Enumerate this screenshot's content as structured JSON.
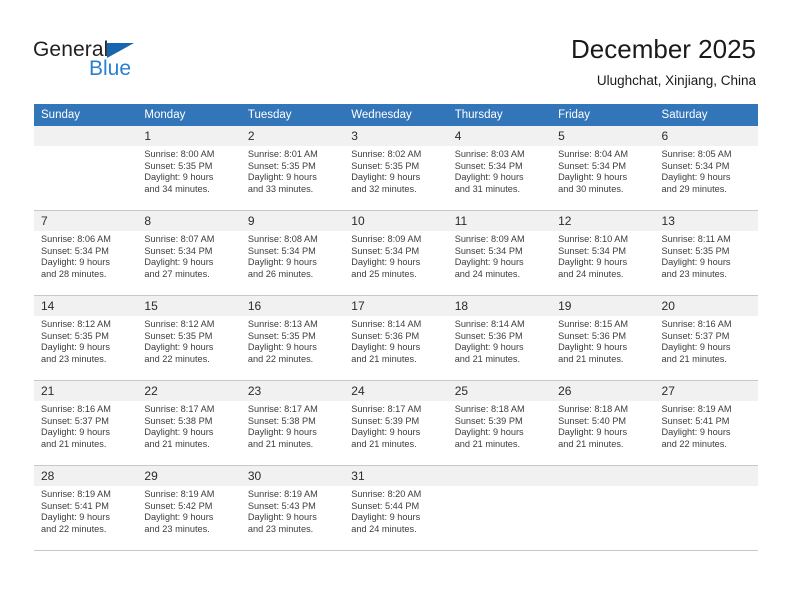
{
  "brand": {
    "name_part1": "General",
    "name_part2": "Blue",
    "triangle_color": "#1565b0",
    "blue_color": "#2a7fd4"
  },
  "header": {
    "title": "December 2025",
    "subtitle": "Ulughchat, Xinjiang, China"
  },
  "theme": {
    "header_row_bg": "#3275b8",
    "daynum_bg": "#f1f1f1",
    "grid_line": "#c8c8c8",
    "text": "#3d3d3d"
  },
  "weekdays": [
    "Sunday",
    "Monday",
    "Tuesday",
    "Wednesday",
    "Thursday",
    "Friday",
    "Saturday"
  ],
  "weeks": [
    [
      {
        "day": "",
        "sunrise": "",
        "sunset": "",
        "daylight1": "",
        "daylight2": ""
      },
      {
        "day": "1",
        "sunrise": "Sunrise: 8:00 AM",
        "sunset": "Sunset: 5:35 PM",
        "daylight1": "Daylight: 9 hours",
        "daylight2": "and 34 minutes."
      },
      {
        "day": "2",
        "sunrise": "Sunrise: 8:01 AM",
        "sunset": "Sunset: 5:35 PM",
        "daylight1": "Daylight: 9 hours",
        "daylight2": "and 33 minutes."
      },
      {
        "day": "3",
        "sunrise": "Sunrise: 8:02 AM",
        "sunset": "Sunset: 5:35 PM",
        "daylight1": "Daylight: 9 hours",
        "daylight2": "and 32 minutes."
      },
      {
        "day": "4",
        "sunrise": "Sunrise: 8:03 AM",
        "sunset": "Sunset: 5:34 PM",
        "daylight1": "Daylight: 9 hours",
        "daylight2": "and 31 minutes."
      },
      {
        "day": "5",
        "sunrise": "Sunrise: 8:04 AM",
        "sunset": "Sunset: 5:34 PM",
        "daylight1": "Daylight: 9 hours",
        "daylight2": "and 30 minutes."
      },
      {
        "day": "6",
        "sunrise": "Sunrise: 8:05 AM",
        "sunset": "Sunset: 5:34 PM",
        "daylight1": "Daylight: 9 hours",
        "daylight2": "and 29 minutes."
      }
    ],
    [
      {
        "day": "7",
        "sunrise": "Sunrise: 8:06 AM",
        "sunset": "Sunset: 5:34 PM",
        "daylight1": "Daylight: 9 hours",
        "daylight2": "and 28 minutes."
      },
      {
        "day": "8",
        "sunrise": "Sunrise: 8:07 AM",
        "sunset": "Sunset: 5:34 PM",
        "daylight1": "Daylight: 9 hours",
        "daylight2": "and 27 minutes."
      },
      {
        "day": "9",
        "sunrise": "Sunrise: 8:08 AM",
        "sunset": "Sunset: 5:34 PM",
        "daylight1": "Daylight: 9 hours",
        "daylight2": "and 26 minutes."
      },
      {
        "day": "10",
        "sunrise": "Sunrise: 8:09 AM",
        "sunset": "Sunset: 5:34 PM",
        "daylight1": "Daylight: 9 hours",
        "daylight2": "and 25 minutes."
      },
      {
        "day": "11",
        "sunrise": "Sunrise: 8:09 AM",
        "sunset": "Sunset: 5:34 PM",
        "daylight1": "Daylight: 9 hours",
        "daylight2": "and 24 minutes."
      },
      {
        "day": "12",
        "sunrise": "Sunrise: 8:10 AM",
        "sunset": "Sunset: 5:34 PM",
        "daylight1": "Daylight: 9 hours",
        "daylight2": "and 24 minutes."
      },
      {
        "day": "13",
        "sunrise": "Sunrise: 8:11 AM",
        "sunset": "Sunset: 5:35 PM",
        "daylight1": "Daylight: 9 hours",
        "daylight2": "and 23 minutes."
      }
    ],
    [
      {
        "day": "14",
        "sunrise": "Sunrise: 8:12 AM",
        "sunset": "Sunset: 5:35 PM",
        "daylight1": "Daylight: 9 hours",
        "daylight2": "and 23 minutes."
      },
      {
        "day": "15",
        "sunrise": "Sunrise: 8:12 AM",
        "sunset": "Sunset: 5:35 PM",
        "daylight1": "Daylight: 9 hours",
        "daylight2": "and 22 minutes."
      },
      {
        "day": "16",
        "sunrise": "Sunrise: 8:13 AM",
        "sunset": "Sunset: 5:35 PM",
        "daylight1": "Daylight: 9 hours",
        "daylight2": "and 22 minutes."
      },
      {
        "day": "17",
        "sunrise": "Sunrise: 8:14 AM",
        "sunset": "Sunset: 5:36 PM",
        "daylight1": "Daylight: 9 hours",
        "daylight2": "and 21 minutes."
      },
      {
        "day": "18",
        "sunrise": "Sunrise: 8:14 AM",
        "sunset": "Sunset: 5:36 PM",
        "daylight1": "Daylight: 9 hours",
        "daylight2": "and 21 minutes."
      },
      {
        "day": "19",
        "sunrise": "Sunrise: 8:15 AM",
        "sunset": "Sunset: 5:36 PM",
        "daylight1": "Daylight: 9 hours",
        "daylight2": "and 21 minutes."
      },
      {
        "day": "20",
        "sunrise": "Sunrise: 8:16 AM",
        "sunset": "Sunset: 5:37 PM",
        "daylight1": "Daylight: 9 hours",
        "daylight2": "and 21 minutes."
      }
    ],
    [
      {
        "day": "21",
        "sunrise": "Sunrise: 8:16 AM",
        "sunset": "Sunset: 5:37 PM",
        "daylight1": "Daylight: 9 hours",
        "daylight2": "and 21 minutes."
      },
      {
        "day": "22",
        "sunrise": "Sunrise: 8:17 AM",
        "sunset": "Sunset: 5:38 PM",
        "daylight1": "Daylight: 9 hours",
        "daylight2": "and 21 minutes."
      },
      {
        "day": "23",
        "sunrise": "Sunrise: 8:17 AM",
        "sunset": "Sunset: 5:38 PM",
        "daylight1": "Daylight: 9 hours",
        "daylight2": "and 21 minutes."
      },
      {
        "day": "24",
        "sunrise": "Sunrise: 8:17 AM",
        "sunset": "Sunset: 5:39 PM",
        "daylight1": "Daylight: 9 hours",
        "daylight2": "and 21 minutes."
      },
      {
        "day": "25",
        "sunrise": "Sunrise: 8:18 AM",
        "sunset": "Sunset: 5:39 PM",
        "daylight1": "Daylight: 9 hours",
        "daylight2": "and 21 minutes."
      },
      {
        "day": "26",
        "sunrise": "Sunrise: 8:18 AM",
        "sunset": "Sunset: 5:40 PM",
        "daylight1": "Daylight: 9 hours",
        "daylight2": "and 21 minutes."
      },
      {
        "day": "27",
        "sunrise": "Sunrise: 8:19 AM",
        "sunset": "Sunset: 5:41 PM",
        "daylight1": "Daylight: 9 hours",
        "daylight2": "and 22 minutes."
      }
    ],
    [
      {
        "day": "28",
        "sunrise": "Sunrise: 8:19 AM",
        "sunset": "Sunset: 5:41 PM",
        "daylight1": "Daylight: 9 hours",
        "daylight2": "and 22 minutes."
      },
      {
        "day": "29",
        "sunrise": "Sunrise: 8:19 AM",
        "sunset": "Sunset: 5:42 PM",
        "daylight1": "Daylight: 9 hours",
        "daylight2": "and 23 minutes."
      },
      {
        "day": "30",
        "sunrise": "Sunrise: 8:19 AM",
        "sunset": "Sunset: 5:43 PM",
        "daylight1": "Daylight: 9 hours",
        "daylight2": "and 23 minutes."
      },
      {
        "day": "31",
        "sunrise": "Sunrise: 8:20 AM",
        "sunset": "Sunset: 5:44 PM",
        "daylight1": "Daylight: 9 hours",
        "daylight2": "and 24 minutes."
      },
      {
        "day": "",
        "sunrise": "",
        "sunset": "",
        "daylight1": "",
        "daylight2": ""
      },
      {
        "day": "",
        "sunrise": "",
        "sunset": "",
        "daylight1": "",
        "daylight2": ""
      },
      {
        "day": "",
        "sunrise": "",
        "sunset": "",
        "daylight1": "",
        "daylight2": ""
      }
    ]
  ]
}
